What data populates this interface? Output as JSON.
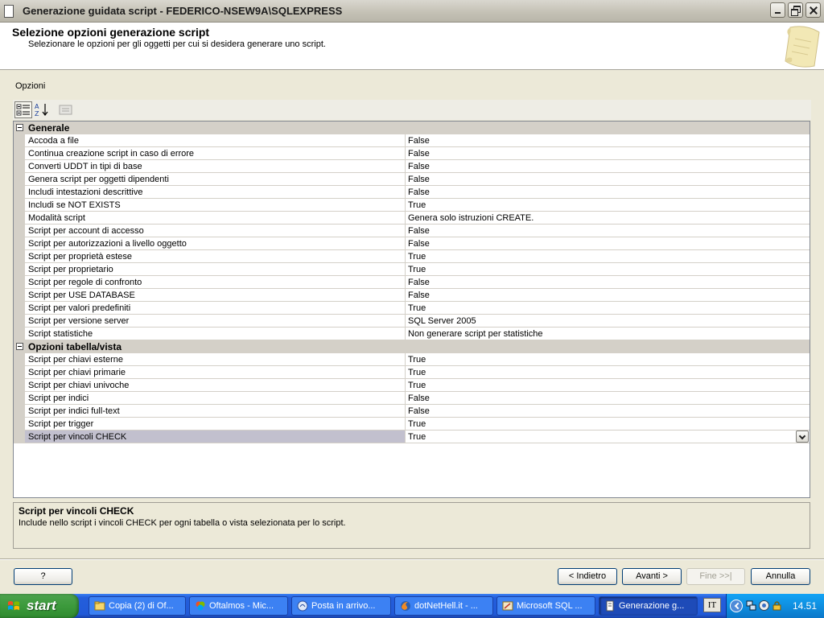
{
  "window": {
    "title": "Generazione guidata script - FEDERICO-NSEW9A\\SQLEXPRESS"
  },
  "header": {
    "title": "Selezione opzioni generazione script",
    "subtitle": "Selezionare le opzioni per gli oggetti per cui si desidera generare uno script."
  },
  "options_label": "Opzioni",
  "grid": {
    "categories": [
      {
        "label": "Generale",
        "rows": [
          {
            "name": "Accoda a file",
            "value": "False"
          },
          {
            "name": "Continua creazione script in caso di errore",
            "value": "False"
          },
          {
            "name": "Converti UDDT in tipi di base",
            "value": "False"
          },
          {
            "name": "Genera script per oggetti dipendenti",
            "value": "False"
          },
          {
            "name": "Includi intestazioni descrittive",
            "value": "False"
          },
          {
            "name": "Includi se NOT EXISTS",
            "value": "True"
          },
          {
            "name": "Modalità script",
            "value": "Genera solo istruzioni CREATE."
          },
          {
            "name": "Script per account di accesso",
            "value": "False"
          },
          {
            "name": "Script per autorizzazioni a livello oggetto",
            "value": "False"
          },
          {
            "name": "Script per proprietà estese",
            "value": "True"
          },
          {
            "name": "Script per proprietario",
            "value": "True"
          },
          {
            "name": "Script per regole di confronto",
            "value": "False"
          },
          {
            "name": "Script per USE DATABASE",
            "value": "False"
          },
          {
            "name": "Script per valori predefiniti",
            "value": "True"
          },
          {
            "name": "Script per versione server",
            "value": "SQL Server 2005"
          },
          {
            "name": "Script statistiche",
            "value": "Non generare script per statistiche"
          }
        ]
      },
      {
        "label": "Opzioni tabella/vista",
        "rows": [
          {
            "name": "Script per chiavi esterne",
            "value": "True"
          },
          {
            "name": "Script per chiavi primarie",
            "value": "True"
          },
          {
            "name": "Script per chiavi univoche",
            "value": "True"
          },
          {
            "name": "Script per indici",
            "value": "False"
          },
          {
            "name": "Script per indici full-text",
            "value": "False"
          },
          {
            "name": "Script per trigger",
            "value": "True"
          },
          {
            "name": "Script per vincoli CHECK",
            "value": "True",
            "selected": true
          }
        ]
      }
    ]
  },
  "description": {
    "title": "Script per vincoli CHECK",
    "text": "Include nello script i vincoli CHECK per ogni tabella o vista selezionata per lo script."
  },
  "buttons": {
    "help": "?",
    "back": "< Indietro",
    "next": "Avanti >",
    "finish": "Fine >>|",
    "cancel": "Annulla"
  },
  "taskbar": {
    "start": "start",
    "tasks": [
      {
        "label": "Copia (2) di Of...",
        "icon": "folder-icon"
      },
      {
        "label": "Oftalmos - Mic...",
        "icon": "office-icon"
      },
      {
        "label": "Posta in arrivo...",
        "icon": "mail-icon"
      },
      {
        "label": "dotNetHell.it - ...",
        "icon": "firefox-icon"
      },
      {
        "label": "Microsoft SQL ...",
        "icon": "sql-icon"
      },
      {
        "label": "Generazione g...",
        "icon": "wizard-icon",
        "active": true
      }
    ],
    "language": "IT",
    "clock": "14.51"
  },
  "colors": {
    "selection": "#c2c0ce",
    "taskbar": "#245edb",
    "start": "#3c9a3c"
  }
}
